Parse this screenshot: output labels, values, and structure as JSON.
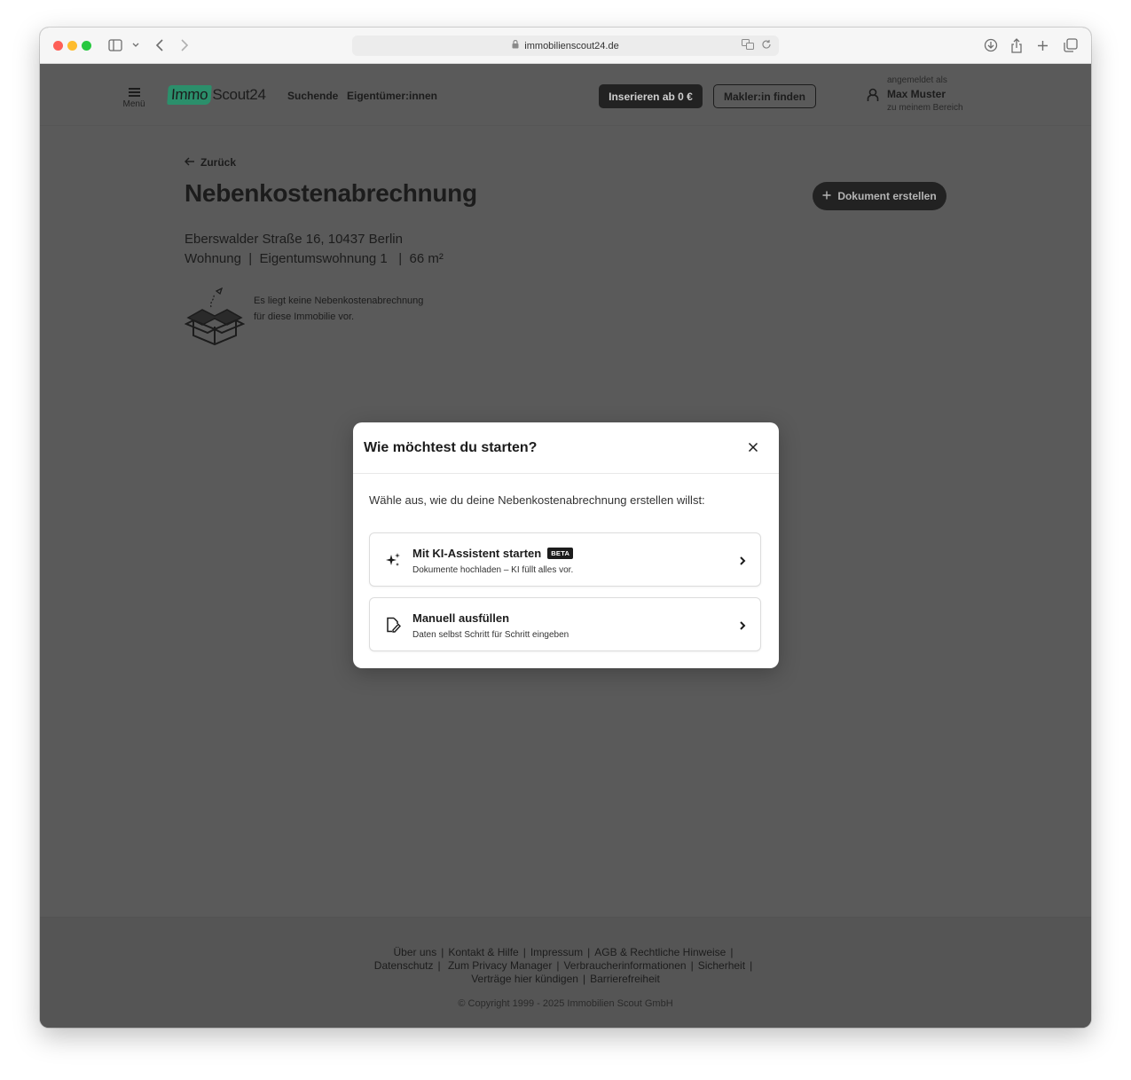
{
  "browser": {
    "url": "immobilienscout24.de"
  },
  "header": {
    "menu_label": "Menü",
    "logo_immo": "Immo",
    "logo_scout": "Scout24",
    "nav": [
      "Suchende",
      "Eigentümer:innen"
    ],
    "cta_dark": "Inserieren ab 0 €",
    "cta_outline": "Makler:in finden",
    "user": {
      "signed_in_label": "angemeldet als",
      "name": "Max Muster",
      "area_link": "zu meinem Bereich"
    }
  },
  "main": {
    "back_label": "Zurück",
    "title": "Nebenkostenabrechnung",
    "create_button": "Dokument erstellen",
    "address": "Eberswalder Straße 16, 10437 Berlin",
    "property_info": "Wohnung  |  Eigentumswohnung 1   |  66 m²",
    "empty_state": "Es liegt keine Nebenkostenabrechnung für diese Immobilie vor."
  },
  "modal": {
    "title": "Wie möchtest du starten?",
    "intro": "Wähle aus, wie du deine Nebenkostenabrechnung erstellen willst:",
    "options": [
      {
        "title": "Mit KI-Assistent starten",
        "badge": "BETA",
        "subtitle": "Dokumente hochladen – KI füllt alles vor.",
        "icon": "sparkles-icon"
      },
      {
        "title": "Manuell ausfüllen",
        "subtitle": "Daten selbst Schritt für Schritt eingeben",
        "icon": "edit-document-icon"
      }
    ]
  },
  "footer": {
    "links_row1": [
      "Über uns",
      "Kontakt & Hilfe",
      "Impressum",
      "AGB & Rechtliche Hinweise"
    ],
    "links_row2": [
      "Datenschutz",
      "Zum Privacy Manager",
      "Verbraucherinformationen",
      "Sicherheit"
    ],
    "links_row3": [
      "Verträge hier kündigen",
      "Barrierefreiheit"
    ],
    "copyright": "© Copyright 1999 - 2025 Immobilien Scout GmbH"
  },
  "colors": {
    "overlay": "#5a5a5a",
    "brand_green": "#2b8f6b",
    "modal_bg": "#ffffff"
  }
}
